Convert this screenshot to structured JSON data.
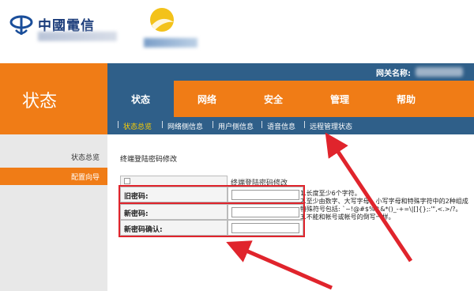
{
  "header": {
    "logo_name": "中國電信",
    "gateway_label": "网关名称:"
  },
  "status_title": "状态",
  "tabs": [
    "状态",
    "网络",
    "安全",
    "管理",
    "帮助"
  ],
  "subtabs": [
    "状态总览",
    "网络侧信息",
    "用户侧信息",
    "语音信息",
    "远程管理状态"
  ],
  "left_nav": [
    "状态总览",
    "配置向导"
  ],
  "content": {
    "section_title": "终端登陆密码修改",
    "table_header": "终端登陆密码修改",
    "fields": [
      {
        "label": "旧密码:",
        "value": ""
      },
      {
        "label": "新密码:",
        "value": ""
      },
      {
        "label": "新密码确认:",
        "value": ""
      }
    ],
    "rules": [
      "1.长度至少6个字符。",
      "2.至少由数字、大写字母，小写字母和特殊字符中的2种组成",
      "特殊符号包括: `~!@#$%^&*()_-+=\\|[]{};:'\",<.>/?。",
      "3.不能和帐号或帐号的倒写一样。"
    ]
  },
  "colors": {
    "orange": "#f07c16",
    "navy": "#2f5f89",
    "highlight_red": "#e0242c"
  },
  "icons": [
    "china-telecom-logo-icon",
    "sun-logo-icon",
    "arrow-icon"
  ]
}
